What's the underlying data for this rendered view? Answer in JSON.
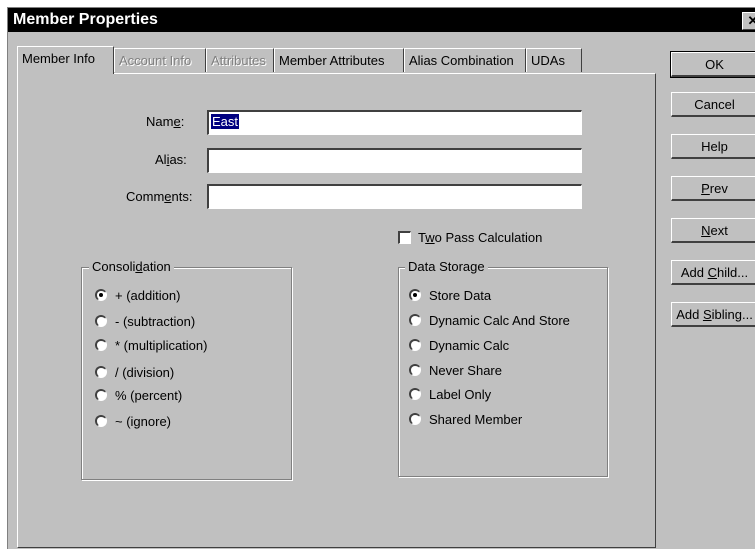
{
  "window": {
    "title": "Member Properties",
    "close_glyph": "✕"
  },
  "tabs": [
    {
      "label": "Member Info",
      "state": "active"
    },
    {
      "label": "Account Info",
      "state": "disabled"
    },
    {
      "label": "Attributes",
      "state": "disabled"
    },
    {
      "label": "Member Attributes",
      "state": "enabled"
    },
    {
      "label": "Alias Combination",
      "state": "enabled"
    },
    {
      "label": "UDAs",
      "state": "enabled"
    }
  ],
  "fields": {
    "name": {
      "label_pre": "Nam",
      "label_ul": "e",
      "label_post": ":",
      "value": "East"
    },
    "alias": {
      "label_pre": "Al",
      "label_ul": "i",
      "label_post": "as:",
      "value": ""
    },
    "comments": {
      "label_pre": "Comm",
      "label_ul": "e",
      "label_post": "nts:",
      "value": ""
    }
  },
  "two_pass": {
    "label_pre": "T",
    "label_ul": "w",
    "label_post": "o Pass Calculation",
    "checked": false
  },
  "consolidation": {
    "title_pre": "Consoli",
    "title_ul": "d",
    "title_post": "ation",
    "options": [
      {
        "label": "+ (addition)",
        "checked": true
      },
      {
        "label": "- (subtraction)",
        "checked": false
      },
      {
        "label": "* (multiplication)",
        "checked": false
      },
      {
        "label": "/ (division)",
        "checked": false
      },
      {
        "label": "% (percent)",
        "checked": false
      },
      {
        "label": "~ (ignore)",
        "checked": false
      }
    ]
  },
  "data_storage": {
    "title": "Data Storage",
    "options": [
      {
        "label": "Store Data",
        "checked": true
      },
      {
        "label": "Dynamic Calc And Store",
        "checked": false
      },
      {
        "label": "Dynamic Calc",
        "checked": false
      },
      {
        "label": "Never Share",
        "checked": false
      },
      {
        "label": "Label Only",
        "checked": false
      },
      {
        "label": "Shared Member",
        "checked": false
      }
    ]
  },
  "buttons": {
    "ok": {
      "label": "OK"
    },
    "cancel": {
      "label": "Cancel"
    },
    "help": {
      "label": "Help"
    },
    "prev": {
      "label_pre": "",
      "label_ul": "P",
      "label_post": "rev"
    },
    "next": {
      "label_pre": "",
      "label_ul": "N",
      "label_post": "ext"
    },
    "add_child": {
      "label_pre": "Add ",
      "label_ul": "C",
      "label_post": "hild..."
    },
    "add_sibling": {
      "label_pre": "Add ",
      "label_ul": "S",
      "label_post": "ibling..."
    }
  }
}
